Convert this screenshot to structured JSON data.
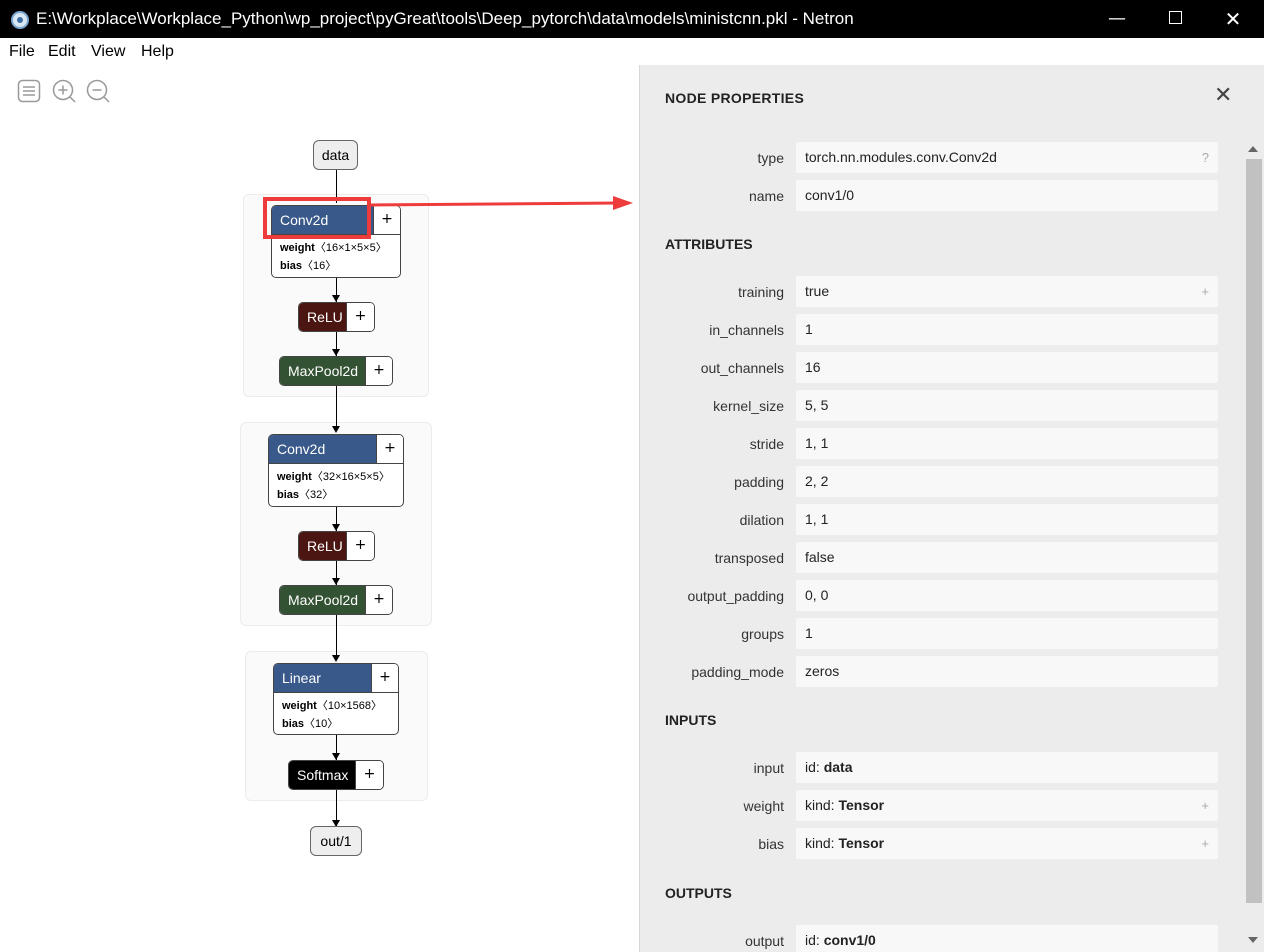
{
  "window": {
    "title": "E:\\Workplace\\Workplace_Python\\wp_project\\pyGreat\\tools\\Deep_pytorch\\data\\models\\ministcnn.pkl - Netron",
    "minimize": "—",
    "close": "✕"
  },
  "menu": [
    "File",
    "Edit",
    "View",
    "Help"
  ],
  "graph": {
    "input_node": "data",
    "output_node": "out/1",
    "plus": "+",
    "conv1": {
      "label": "Conv2d",
      "weight_key": "weight",
      "weight_val": "〈16×1×5×5〉",
      "bias_key": "bias",
      "bias_val": "〈16〉"
    },
    "relu1": "ReLU",
    "pool1": "MaxPool2d",
    "conv2": {
      "label": "Conv2d",
      "weight_key": "weight",
      "weight_val": "〈32×16×5×5〉",
      "bias_key": "bias",
      "bias_val": "〈32〉"
    },
    "relu2": "ReLU",
    "pool2": "MaxPool2d",
    "linear": {
      "label": "Linear",
      "weight_key": "weight",
      "weight_val": "〈10×1568〉",
      "bias_key": "bias",
      "bias_val": "〈10〉"
    },
    "softmax": "Softmax"
  },
  "colors": {
    "conv": "#39598a",
    "relu": "#4b1612",
    "pool": "#335233",
    "softmax": "#000000",
    "highlight": "#ee3b3b"
  },
  "properties": {
    "title": "NODE PROPERTIES",
    "close": "✕",
    "type_label": "type",
    "type_value": "torch.nn.modules.conv.Conv2d",
    "type_help": "?",
    "name_label": "name",
    "name_value": "conv1/0",
    "attributes_title": "ATTRIBUTES",
    "attributes": [
      {
        "label": "training",
        "value": "true",
        "extra": "+"
      },
      {
        "label": "in_channels",
        "value": "1",
        "extra": ""
      },
      {
        "label": "out_channels",
        "value": "16",
        "extra": ""
      },
      {
        "label": "kernel_size",
        "value": "5, 5",
        "extra": ""
      },
      {
        "label": "stride",
        "value": "1, 1",
        "extra": ""
      },
      {
        "label": "padding",
        "value": "2, 2",
        "extra": ""
      },
      {
        "label": "dilation",
        "value": "1, 1",
        "extra": ""
      },
      {
        "label": "transposed",
        "value": "false",
        "extra": ""
      },
      {
        "label": "output_padding",
        "value": "0, 0",
        "extra": ""
      },
      {
        "label": "groups",
        "value": "1",
        "extra": ""
      },
      {
        "label": "padding_mode",
        "value": "zeros",
        "extra": ""
      }
    ],
    "inputs_title": "INPUTS",
    "inputs": [
      {
        "label": "input",
        "prefix": "id: ",
        "value": "data",
        "extra": ""
      },
      {
        "label": "weight",
        "prefix": "kind: ",
        "value": "Tensor",
        "extra": "+"
      },
      {
        "label": "bias",
        "prefix": "kind: ",
        "value": "Tensor",
        "extra": "+"
      }
    ],
    "outputs_title": "OUTPUTS",
    "outputs": [
      {
        "label": "output",
        "prefix": "id: ",
        "value": "conv1/0",
        "extra": ""
      }
    ]
  }
}
